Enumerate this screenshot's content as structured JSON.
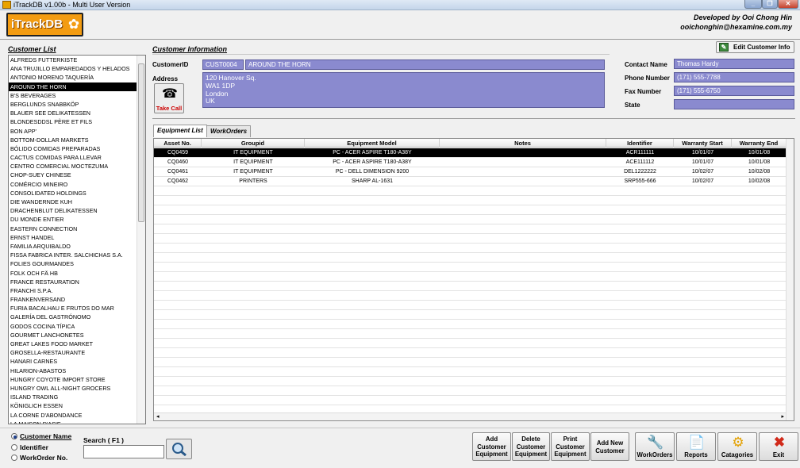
{
  "window": {
    "title": "iTrackDB v1.00b - Multi User Version"
  },
  "header": {
    "logo_text": "iTrackDB",
    "developer": "Developed by Ooi Chong Hin",
    "email": "ooichonghin@hexamine.com.my"
  },
  "customer_list": {
    "title": "Customer List",
    "selected": "AROUND THE HORN",
    "items": [
      "ALFREDS FUTTERKISTE",
      "ANA TRUJILLO EMPAREDADOS Y HELADOS",
      "ANTONIO MORENO TAQUERÍA",
      "AROUND THE HORN",
      "B'S BEVERAGES",
      "BERGLUNDS SNABBKÖP",
      "BLAUER SEE DELIKATESSEN",
      "BLONDESDDSL PÈRE ET FILS",
      "BON APP'",
      "BOTTOM-DOLLAR MARKETS",
      "BÓLIDO COMIDAS PREPARADAS",
      "CACTUS COMIDAS PARA LLEVAR",
      "CENTRO COMERCIAL MOCTEZUMA",
      "CHOP-SUEY CHINESE",
      "COMÉRCIO MINEIRO",
      "CONSOLIDATED HOLDINGS",
      "DIE WANDERNDE KUH",
      "DRACHENBLUT DELIKATESSEN",
      "DU MONDE ENTIER",
      "EASTERN CONNECTION",
      "ERNST HANDEL",
      "FAMILIA ARQUIBALDO",
      "FISSA FABRICA INTER. SALCHICHAS S.A.",
      "FOLIES GOURMANDES",
      "FOLK OCH FÄ HB",
      "FRANCE RESTAURATION",
      "FRANCHI S.P.A.",
      "FRANKENVERSAND",
      "FURIA BACALHAU E FRUTOS DO MAR",
      "GALERÍA DEL GASTRÓNOMO",
      "GODOS COCINA TÍPICA",
      "GOURMET LANCHONETES",
      "GREAT LAKES FOOD MARKET",
      "GROSELLA-RESTAURANTE",
      "HANARI CARNES",
      "HILARION-ABASTOS",
      "HUNGRY COYOTE IMPORT STORE",
      "HUNGRY OWL ALL-NIGHT GROCERS",
      "ISLAND TRADING",
      "KÖNIGLICH ESSEN",
      "LA CORNE D'ABONDANCE",
      "LA MAISON D'ASIE"
    ]
  },
  "customer_info": {
    "title": "Customer Information",
    "id_label": "CustomerID",
    "id_value": "CUST0004",
    "name_value": "AROUND THE HORN",
    "address_label": "Address",
    "address_lines": [
      "120 Hanover Sq.",
      "WA1 1DP",
      "London",
      "UK"
    ],
    "contact_label": "Contact Name",
    "contact_value": "Thomas Hardy",
    "phone_label": "Phone Number",
    "phone_value": "(171) 555-7788",
    "fax_label": "Fax Number",
    "fax_value": "(171) 555-6750",
    "state_label": "State",
    "state_value": "",
    "take_call_label": "Take Call",
    "edit_button_label": "Edit Customer Info"
  },
  "tabs": [
    {
      "label": "Equipment List",
      "active": true
    },
    {
      "label": "WorkOrders",
      "active": false
    }
  ],
  "equipment_table": {
    "columns": [
      "Asset No.",
      "Groupid",
      "Equipment Model",
      "Notes",
      "Identifier",
      "Warranty Start",
      "Warranty End"
    ],
    "rows": [
      [
        "CQ0459",
        "IT EQUIPMENT",
        "PC - ACER ASPIRE T180-A38Y",
        "",
        "ACR111111",
        "10/01/07",
        "10/01/08"
      ],
      [
        "CQ0460",
        "IT EQUIPMENT",
        "PC - ACER ASPIRE T180-A38Y",
        "",
        "ACE111112",
        "10/01/07",
        "10/01/08"
      ],
      [
        "CQ0461",
        "IT EQUIPMENT",
        "PC - DELL DIMENSION 9200",
        "",
        "DEL1222222",
        "10/02/07",
        "10/02/08"
      ],
      [
        "CQ0462",
        "PRINTERS",
        "SHARP AL-1631",
        "",
        "SRP555-666",
        "10/02/07",
        "10/02/08"
      ]
    ],
    "selected_row": 0
  },
  "search": {
    "options": [
      {
        "label": "Customer Name",
        "selected": true
      },
      {
        "label": "Identifier",
        "selected": false
      },
      {
        "label": "WorkOrder No.",
        "selected": false
      }
    ],
    "label": "Search ( F1 )",
    "value": ""
  },
  "actions": {
    "add_customer_equipment": "Add\nCustomer\nEquipment",
    "delete_customer_equipment": "Delete\nCustomer\nEquipment",
    "print_customer_equipment": "Print\nCustomer\nEquipment",
    "add_new_customer": "Add New\nCustomer",
    "workorders": "WorkOrders",
    "reports": "Reports",
    "catagories": "Catagories",
    "exit": "Exit"
  },
  "colors": {
    "field_bg": "#8a8acf",
    "logo_bg": "#f39c12",
    "take_call_text": "#cc0000"
  }
}
